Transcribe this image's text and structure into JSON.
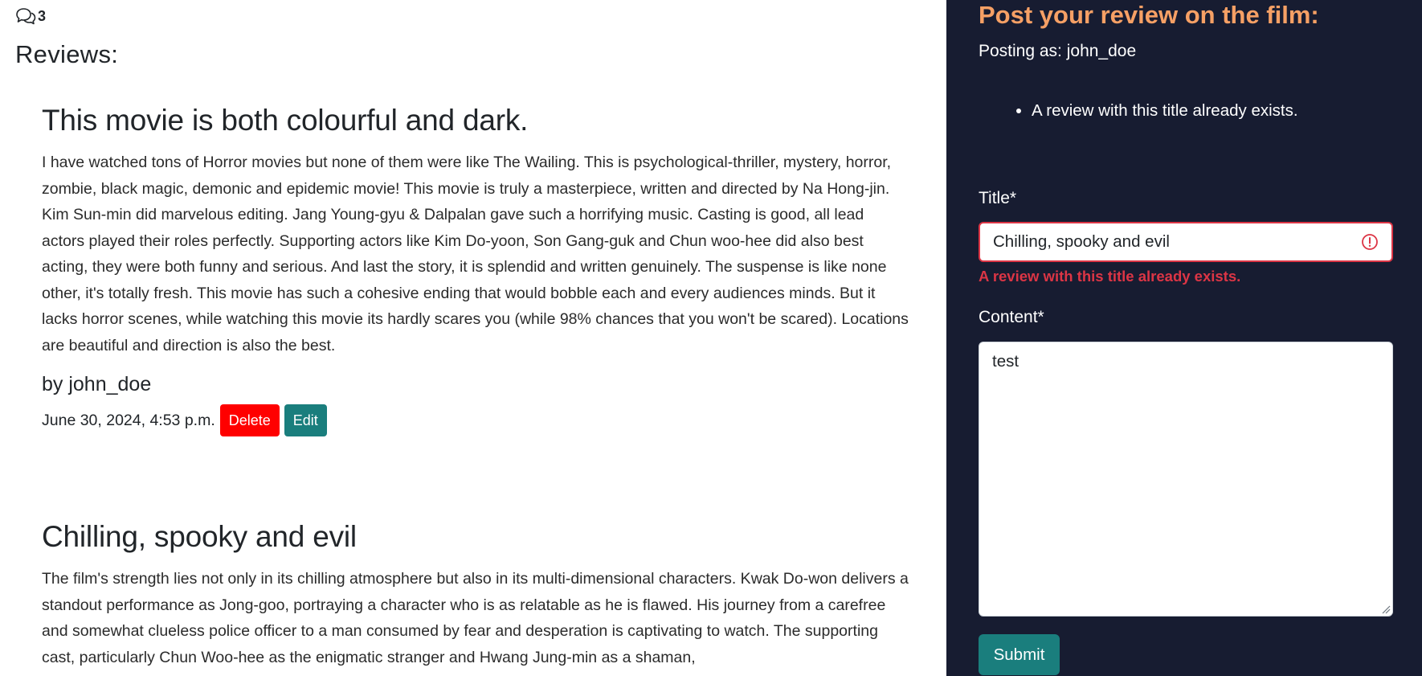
{
  "reviews_section": {
    "comment_count": "3",
    "heading": "Reviews:",
    "items": [
      {
        "title": "This movie is both colourful and dark.",
        "body": "I have watched tons of Horror movies but none of them were like The Wailing. This is psychological-thriller, mystery, horror, zombie, black magic, demonic and epidemic movie! This movie is truly a masterpiece, written and directed by Na Hong-jin. Kim Sun-min did marvelous editing. Jang Young-gyu & Dalpalan gave such a horrifying music. Casting is good, all lead actors played their roles perfectly. Supporting actors like Kim Do-yoon, Son Gang-guk and Chun woo-hee did also best acting, they were both funny and serious. And last the story, it is splendid and written genuinely. The suspense is like none other, it's totally fresh. This movie has such a cohesive ending that would bobble each and every audiences minds. But it lacks horror scenes, while watching this movie its hardly scares you (while 98% chances that you won't be scared). Locations are beautiful and direction is also the best.",
        "author": "by john_doe",
        "date": "June 30, 2024, 4:53 p.m.",
        "delete_label": "Delete",
        "edit_label": "Edit"
      },
      {
        "title": "Chilling, spooky and evil",
        "body": "The film's strength lies not only in its chilling atmosphere but also in its multi-dimensional characters. Kwak Do-won delivers a standout performance as Jong-goo, portraying a character who is as relatable as he is flawed. His journey from a carefree and somewhat clueless police officer to a man consumed by fear and desperation is captivating to watch. The supporting cast, particularly Chun Woo-hee as the enigmatic stranger and Hwang Jung-min as a shaman,"
      }
    ]
  },
  "review_form": {
    "heading": "Post your review on the film:",
    "posting_as": "Posting as: john_doe",
    "errors": [
      "A review with this title already exists."
    ],
    "title_label": "Title*",
    "title_value": "Chilling, spooky and evil",
    "title_error": "A review with this title already exists.",
    "content_label": "Content*",
    "content_value": "test",
    "submit_label": "Submit"
  },
  "colors": {
    "panel_bg": "#171c31",
    "heading_accent": "#f6a065",
    "error": "#dc3545",
    "delete_button": "#ff0000",
    "teal_button": "#1a7e7d"
  },
  "icons": {
    "comment_count": "chat-bubbles-icon",
    "title_error": "exclamation-circle-icon"
  }
}
